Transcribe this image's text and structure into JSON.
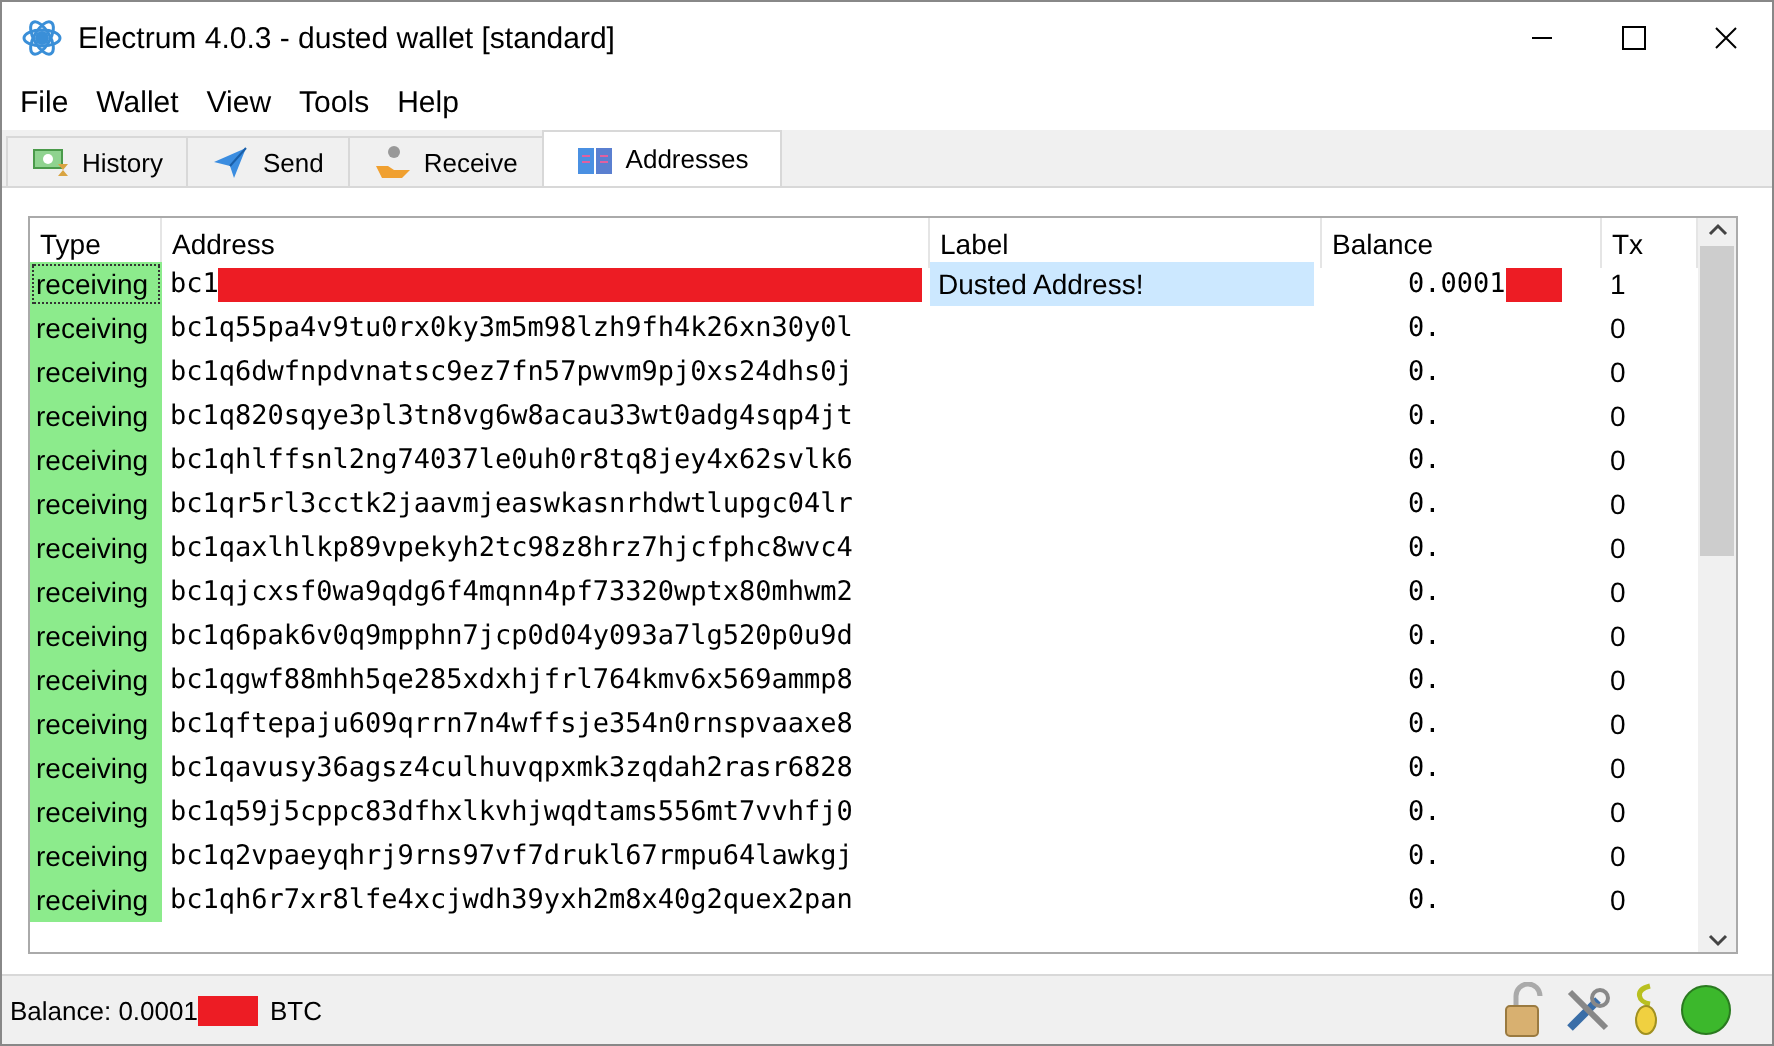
{
  "window": {
    "title": "Electrum 4.0.3  -  dusted wallet  [standard]"
  },
  "menu": [
    "File",
    "Wallet",
    "View",
    "Tools",
    "Help"
  ],
  "tabs": [
    {
      "label": "History",
      "selected": false
    },
    {
      "label": "Send",
      "selected": false
    },
    {
      "label": "Receive",
      "selected": false
    },
    {
      "label": "Addresses",
      "selected": true
    }
  ],
  "table": {
    "columns": [
      "Type",
      "Address",
      "Label",
      "Balance",
      "Tx"
    ],
    "rows": [
      {
        "type": "receiving",
        "address": "bc1",
        "label": "Dusted Address!",
        "balance": "0.0001",
        "tx": "1",
        "redacted": true,
        "selected": true
      },
      {
        "type": "receiving",
        "address": "bc1q55pa4v9tu0rx0ky3m5m98lzh9fh4k26xn30y0l",
        "balance": "0.",
        "tx": "0",
        "selected": false
      },
      {
        "type": "receiving",
        "address": "bc1q6dwfnpdvnatsc9ez7fn57pwvm9pj0xs24dhs0j",
        "balance": "0.",
        "tx": "0",
        "selected": false
      },
      {
        "type": "receiving",
        "address": "bc1q820sqye3pl3tn8vg6w8acau33wt0adg4sqp4jt",
        "balance": "0.",
        "tx": "0",
        "selected": false
      },
      {
        "type": "receiving",
        "address": "bc1qhlffsnl2ng74037le0uh0r8tq8jey4x62svlk6",
        "balance": "0.",
        "tx": "0",
        "selected": false
      },
      {
        "type": "receiving",
        "address": "bc1qr5rl3cctk2jaavmjeaswkasnrhdwtlupgc04lr",
        "balance": "0.",
        "tx": "0",
        "selected": false
      },
      {
        "type": "receiving",
        "address": "bc1qaxlhlkp89vpekyh2tc98z8hrz7hjcfphc8wvc4",
        "balance": "0.",
        "tx": "0",
        "selected": false
      },
      {
        "type": "receiving",
        "address": "bc1qjcxsf0wa9qdg6f4mqnn4pf73320wptx80mhwm2",
        "balance": "0.",
        "tx": "0",
        "selected": false
      },
      {
        "type": "receiving",
        "address": "bc1q6pak6v0q9mpphn7jcp0d04y093a7lg520p0u9d",
        "balance": "0.",
        "tx": "0",
        "selected": false
      },
      {
        "type": "receiving",
        "address": "bc1qgwf88mhh5qe285xdxhjfrl764kmv6x569ammp8",
        "balance": "0.",
        "tx": "0",
        "selected": false
      },
      {
        "type": "receiving",
        "address": "bc1qftepaju609qrrn7n4wffsje354n0rnspvaaxe8",
        "balance": "0.",
        "tx": "0",
        "selected": false
      },
      {
        "type": "receiving",
        "address": "bc1qavusy36agsz4culhuvqpxmk3zqdah2rasr6828",
        "balance": "0.",
        "tx": "0",
        "selected": false
      },
      {
        "type": "receiving",
        "address": "bc1q59j5cppc83dfhxlkvhjwqdtams556mt7vvhfj0",
        "balance": "0.",
        "tx": "0",
        "selected": false
      },
      {
        "type": "receiving",
        "address": "bc1q2vpaeyqhrj9rns97vf7drukl67rmpu64lawkgj",
        "balance": "0.",
        "tx": "0",
        "selected": false
      },
      {
        "type": "receiving",
        "address": "bc1qh6r7xr8lfe4xcjwdh39yxh2m8x40g2quex2pan",
        "balance": "0.",
        "tx": "0",
        "selected": false
      }
    ]
  },
  "status_bar": {
    "balance": "Balance: 0.0001",
    "unit": "BTC",
    "redacted": true
  }
}
